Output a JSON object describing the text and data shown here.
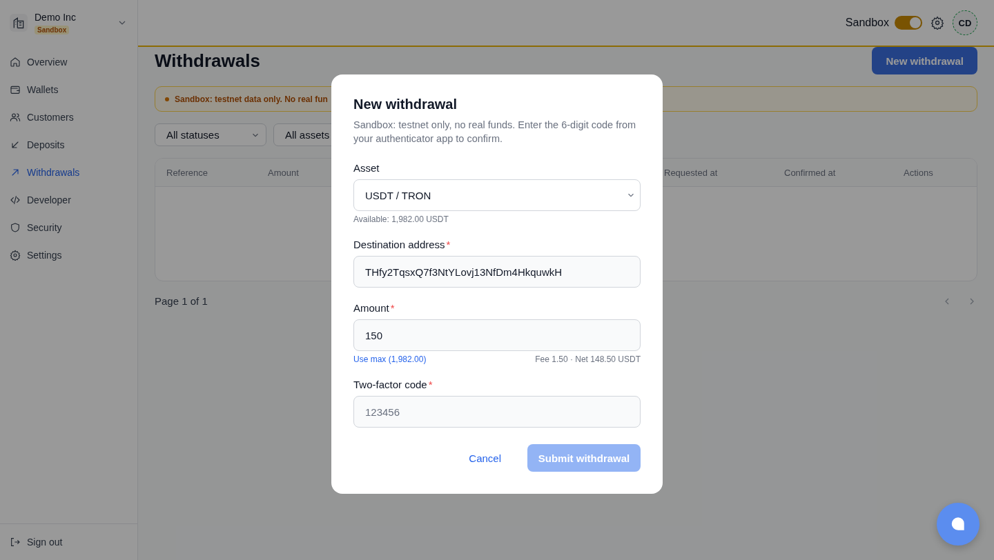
{
  "sidebar": {
    "org": {
      "name": "Demo Inc",
      "badge": "Sandbox"
    },
    "items": [
      {
        "label": "Overview",
        "selected": false
      },
      {
        "label": "Wallets",
        "selected": false
      },
      {
        "label": "Customers",
        "selected": false
      },
      {
        "label": "Deposits",
        "selected": false
      },
      {
        "label": "Withdrawals",
        "selected": true
      },
      {
        "label": "Developer",
        "selected": false
      },
      {
        "label": "Security",
        "selected": false
      },
      {
        "label": "Settings",
        "selected": false
      }
    ],
    "sign_out": "Sign out"
  },
  "header": {
    "sandbox": {
      "label": "Sandbox",
      "on": true
    },
    "avatar": "CD"
  },
  "page": {
    "title": "Withdrawals",
    "primary_button": "New withdrawal",
    "banner": "Sandbox: testnet data only. No real fun",
    "filters": [
      "All statuses",
      "All assets"
    ],
    "table": {
      "columns": [
        "Reference",
        "Amount",
        "Requested at",
        "Confirmed at",
        "Actions"
      ]
    },
    "pagination": "Page 1 of 1"
  },
  "modal": {
    "title": "New withdrawal",
    "description": "Sandbox: testnet only, no real funds. Enter the 6-digit code from your authenticator app to confirm.",
    "fields": [
      {
        "kind": "select",
        "label": "Asset",
        "value": "USDT / TRON",
        "hint": "Available: 1,982.00 USDT"
      },
      {
        "kind": "text",
        "label": "Destination address",
        "required_mark": "*",
        "value": "THfy2TqsxQ7f3NtYLovj13NfDm4HkquwkH"
      },
      {
        "kind": "amount",
        "label": "Amount",
        "required_mark": "*",
        "value": "150",
        "link": "Use max (1,982.00)",
        "note": "Fee 1.50 · Net 148.50 USDT"
      },
      {
        "kind": "text",
        "label": "Two-factor code",
        "required_mark": "*",
        "placeholder": "123456"
      }
    ],
    "cancel": "Cancel",
    "submit": {
      "label": "Submit withdrawal",
      "disabled": true
    }
  }
}
